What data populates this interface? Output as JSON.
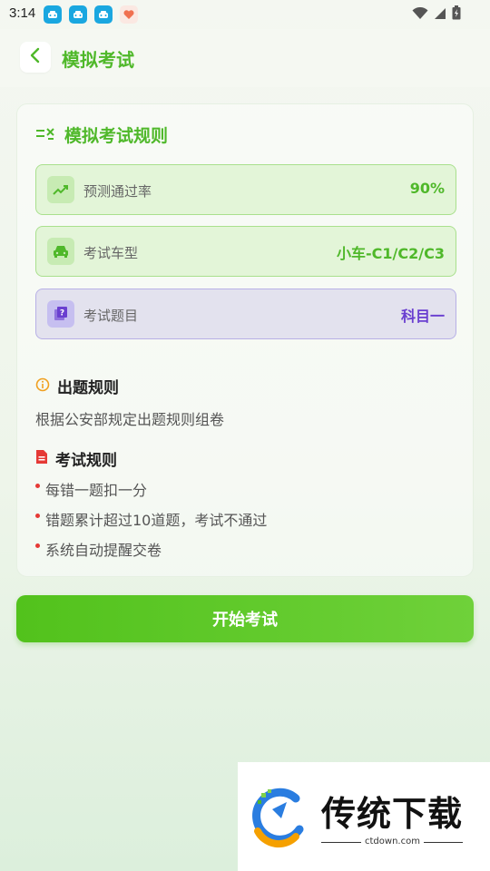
{
  "status_bar": {
    "time": "3:14",
    "app_icons": [
      "car-app-icon",
      "car-app-icon",
      "car-app-icon",
      "heart-app-icon"
    ]
  },
  "header": {
    "title": "模拟考试"
  },
  "rules_card": {
    "title": "模拟考试规则",
    "rows": [
      {
        "icon": "trend-up-icon",
        "label": "预测通过率",
        "value": "90%"
      },
      {
        "icon": "car-icon",
        "label": "考试车型",
        "value": "小车-C1/C2/C3"
      },
      {
        "icon": "question-book-icon",
        "label": "考试题目",
        "value": "科目一"
      }
    ],
    "question_rules": {
      "title": "出题规则",
      "text": "根据公安部规定出题规则组卷"
    },
    "exam_rules": {
      "title": "考试规则",
      "items": [
        "每错一题扣一分",
        "错题累计超过10道题，考试不通过",
        "系统自动提醒交卷"
      ]
    }
  },
  "start_button": {
    "label": "开始考试"
  },
  "watermark": {
    "title": "传统下载",
    "subtitle": "ctdown.com"
  },
  "colors": {
    "accent_green": "#4fb82a",
    "purple_value": "#6a3fd0",
    "bullet_red": "#e53935"
  }
}
